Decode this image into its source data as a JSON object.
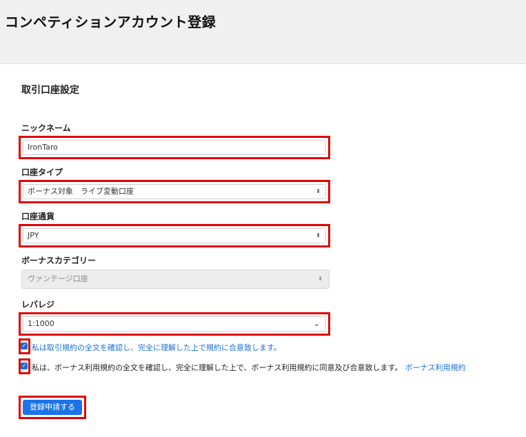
{
  "page": {
    "title": "コンペティションアカウント登録"
  },
  "form": {
    "section_title": "取引口座設定",
    "nickname": {
      "label": "ニックネーム",
      "value": "IronTaro"
    },
    "account_type": {
      "label": "口座タイプ",
      "value": "ボーナス対象　ライブ変動口座"
    },
    "currency": {
      "label": "口座通貨",
      "value": "JPY"
    },
    "bonus_category": {
      "label": "ボーナスカテゴリー",
      "value": "ヴァンテージ口座"
    },
    "leverage": {
      "label": "レバレジ",
      "value": "1:1000"
    },
    "consent_terms": {
      "checked": true,
      "text": "私は取引規約の全文を確認し、完全に理解した上で規約に合意致します。"
    },
    "consent_bonus": {
      "checked": true,
      "text": "私は、ボーナス利用規約の全文を確認し、完全に理解した上で、ボーナス利用規約に同意及び合意致します。",
      "link": "ボーナス利用規約"
    },
    "submit_label": "登録申請する"
  },
  "colors": {
    "highlight": "#e00000",
    "accent": "#1a73e8"
  },
  "icons": {
    "select": "up-down-arrows-icon",
    "leverage": "chevron-down-icon",
    "check": "checkmark-icon"
  }
}
